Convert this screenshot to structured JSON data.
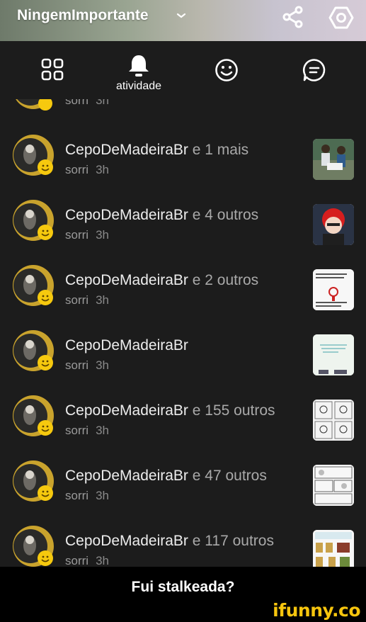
{
  "header": {
    "username": "NingemImportante",
    "icons": [
      "chevron-down-icon",
      "share-icon",
      "hexagon-settings-icon"
    ]
  },
  "tabs": {
    "active_label": "atividade",
    "icons": [
      "grid-icon",
      "bell-icon",
      "smiley-icon",
      "chat-icon"
    ]
  },
  "partial_row": {
    "action": "sorri",
    "time": "3h"
  },
  "rows": [
    {
      "name": "CepoDeMadeiraBr",
      "rest": "e 1 mais",
      "action": "sorri",
      "time": "3h"
    },
    {
      "name": "CepoDeMadeiraBr",
      "rest": "e 4 outros",
      "action": "sorri",
      "time": "3h"
    },
    {
      "name": "CepoDeMadeiraBr",
      "rest": "e 2 outros",
      "action": "sorri",
      "time": "3h"
    },
    {
      "name": "CepoDeMadeiraBr",
      "rest": "",
      "action": "sorri",
      "time": "3h"
    },
    {
      "name": "CepoDeMadeiraBr",
      "rest": "e 155 outros",
      "action": "sorri",
      "time": "3h"
    },
    {
      "name": "CepoDeMadeiraBr",
      "rest": "e 47 outros",
      "action": "sorri",
      "time": "3h"
    },
    {
      "name": "CepoDeMadeiraBr",
      "rest": "e 117 outros",
      "action": "sorri",
      "time": "3h"
    }
  ],
  "caption": "Fui stalkeada?",
  "watermark": "ifunny.co",
  "colors": {
    "background": "#1c1c1c",
    "emoji_yellow": "#f6c90e",
    "watermark": "#f6c50e"
  }
}
